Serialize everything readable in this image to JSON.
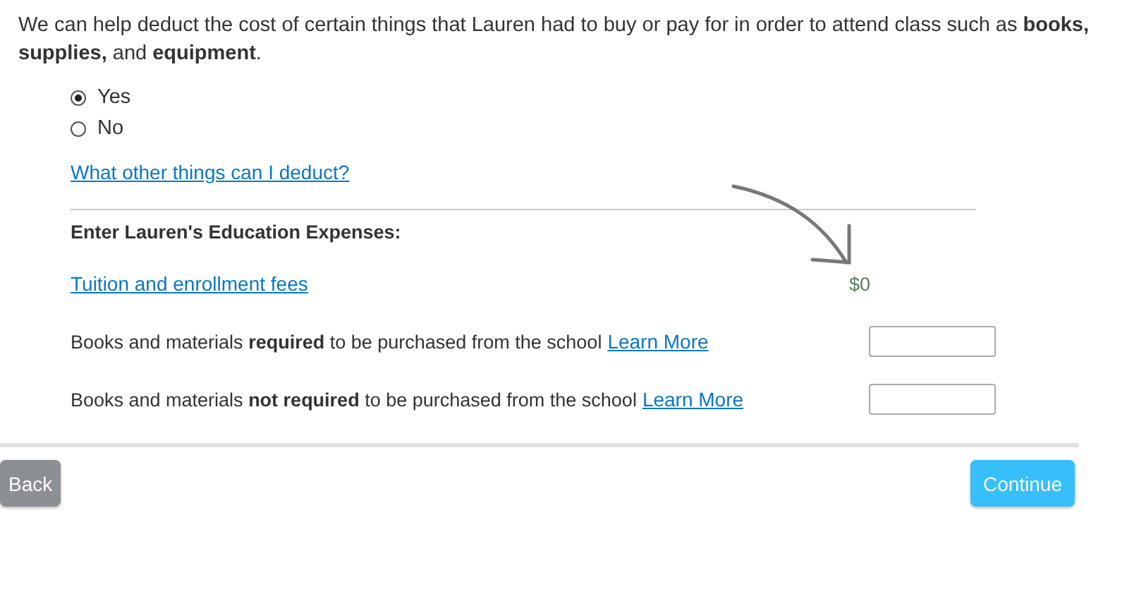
{
  "intro": "We can help deduct the cost of certain things that Lauren had to buy or pay for in order to attend class such as **books, supplies,** and **equipment**.",
  "options": [
    {
      "label": "Yes",
      "selected": true
    },
    {
      "label": "No",
      "selected": false
    }
  ],
  "help_link": "What other things can I deduct?",
  "expenses": {
    "heading": "Enter Lauren's Education Expenses:",
    "rows": [
      {
        "kind": "link",
        "label": "Tuition and enrollment fees",
        "amount": "$0"
      },
      {
        "kind": "input",
        "label": "Books and materials **required** to be purchased from the school",
        "link": "Learn More"
      },
      {
        "kind": "input",
        "label": "Books and materials **not required** to be purchased from the school",
        "link": "Learn More"
      }
    ]
  },
  "buttons": {
    "back": "Back",
    "continue": "Continue"
  }
}
